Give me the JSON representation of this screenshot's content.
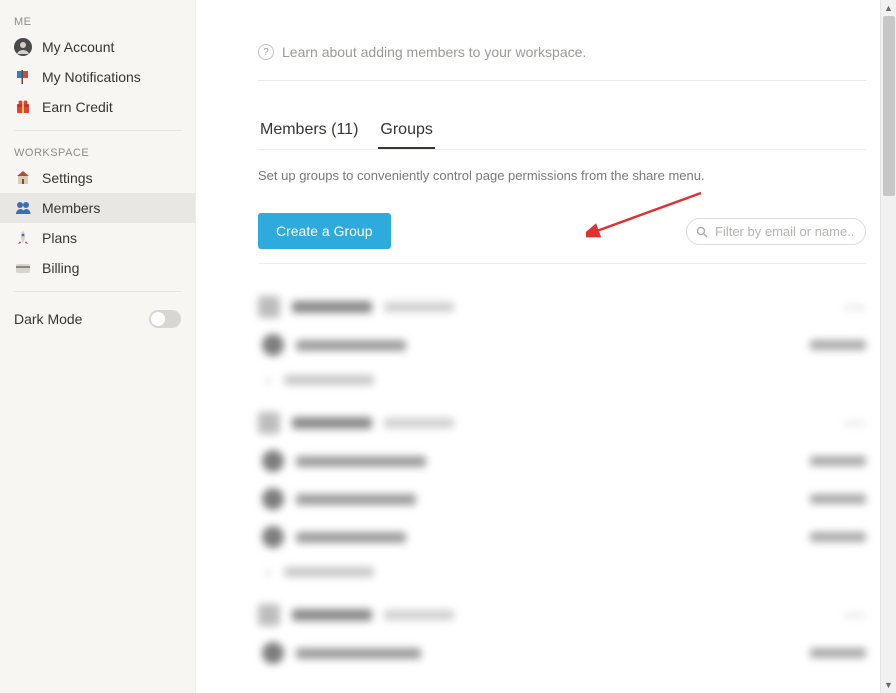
{
  "sidebar": {
    "me_label": "ME",
    "workspace_label": "WORKSPACE",
    "items_me": [
      {
        "label": "My Account"
      },
      {
        "label": "My Notifications"
      },
      {
        "label": "Earn Credit"
      }
    ],
    "items_ws": [
      {
        "label": "Settings"
      },
      {
        "label": "Members"
      },
      {
        "label": "Plans"
      },
      {
        "label": "Billing"
      }
    ],
    "dark_mode_label": "Dark Mode"
  },
  "main": {
    "help_text": "Learn about adding members to your workspace.",
    "tabs": {
      "members": "Members (11)",
      "groups": "Groups"
    },
    "groups_subtitle": "Set up groups to conveniently control page permissions from the share menu.",
    "create_group_label": "Create a Group",
    "filter_placeholder": "Filter by email or name..."
  }
}
